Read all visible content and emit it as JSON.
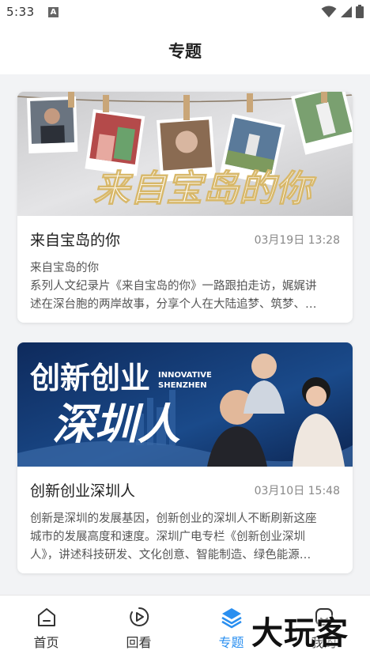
{
  "status": {
    "time": "5:33",
    "notif_icon_letter": "A"
  },
  "header": {
    "title": "专题"
  },
  "cards": [
    {
      "title": "来自宝岛的你",
      "date": "03月19日 13:28",
      "desc_lines": [
        "来自宝岛的你",
        "系列人文纪录片《来自宝岛的你》一路跟拍走访，娓娓讲",
        "述在深台胞的两岸故事，分享个人在大陆追梦、筑梦、…"
      ],
      "image_text": "来自宝岛的你"
    },
    {
      "title": "创新创业深圳人",
      "date": "03月10日 15:48",
      "desc_lines": [
        "创新是深圳的发展基因，创新创业的深圳人不断刷新这座",
        "城市的发展高度和速度。深圳广电专栏《创新创业深圳",
        "人》，讲述科技研发、文化创意、智能制造、绿色能源…"
      ],
      "image_text_top": "创新创业",
      "image_text_en_1": "INNOVATIVE",
      "image_text_en_2": "SHENZHEN",
      "image_text_bottom": "深圳人"
    }
  ],
  "tabs": [
    {
      "label": "首页",
      "icon": "home-icon"
    },
    {
      "label": "回看",
      "icon": "replay-icon"
    },
    {
      "label": "专题",
      "icon": "layers-icon",
      "active": true
    },
    {
      "label": "我的",
      "icon": "profile-icon"
    }
  ],
  "colors": {
    "accent": "#2a8ff0",
    "background": "#f2f3f5"
  },
  "watermark": "大玩客"
}
